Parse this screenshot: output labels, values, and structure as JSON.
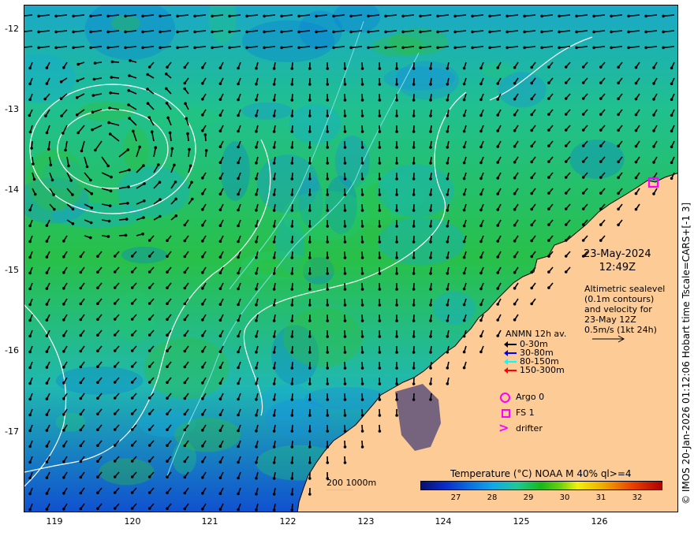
{
  "map": {
    "x_ticks": [
      "119",
      "120",
      "121",
      "122",
      "123",
      "124",
      "125",
      "126"
    ],
    "y_ticks": [
      "-12",
      "-13",
      "-14",
      "-15",
      "-16",
      "-17"
    ],
    "lon_range": [
      118.6,
      126.98
    ],
    "lat_range": [
      -12.0,
      -17.9
    ],
    "colors": {
      "ocean": "#1eb4a0",
      "land": "#fdcb96",
      "contour": "#ffffff",
      "isobath": "#7fe0e6"
    }
  },
  "date": {
    "day": "23-May-2024",
    "time": "12:49Z"
  },
  "altimetry": {
    "lines": [
      "Altimetric sealevel",
      "(0.1m contours)",
      "and velocity for",
      "23-May 12Z",
      "0.5m/s (1kt 24h)"
    ]
  },
  "anmn": {
    "title": "ANMN 12h av.",
    "rows": [
      {
        "label": "0-30m",
        "color": "#000000"
      },
      {
        "label": "30-80m",
        "color": "#0000ff"
      },
      {
        "label": "80-150m",
        "color": "#00ffff"
      },
      {
        "label": "150-300m",
        "color": "#ff0000"
      }
    ]
  },
  "markers": {
    "argo": "Argo 0",
    "fs": "FS 1",
    "drifter": "drifter"
  },
  "contour_legend": "200  1000m",
  "colorbar": {
    "title": "Temperature (°C) NOAA  M 40% ql>=4",
    "ticks": [
      "27",
      "28",
      "29",
      "30",
      "31",
      "32"
    ]
  },
  "credit": "© IMOS 20-Jan-2026 01:12:06 Hobart time Tscale=CARS+[-1 3]"
}
